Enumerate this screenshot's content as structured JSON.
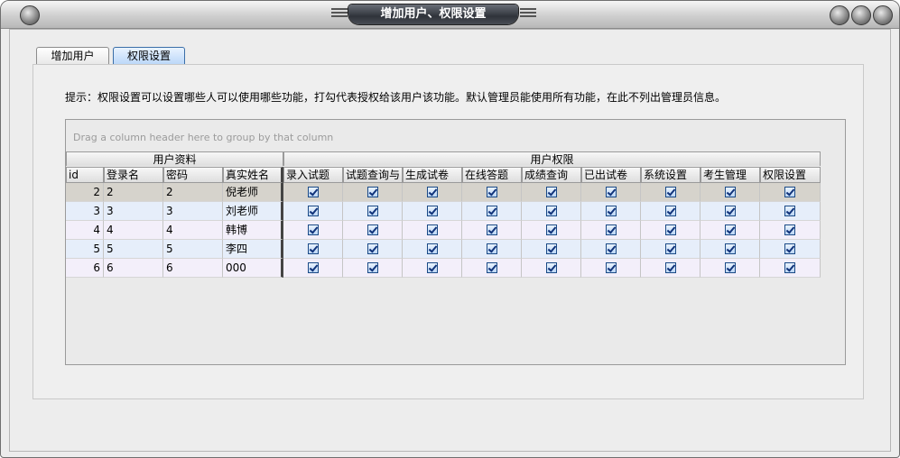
{
  "window": {
    "title": "增加用户、权限设置"
  },
  "tabs": [
    {
      "label": "增加用户",
      "active": false
    },
    {
      "label": "权限设置",
      "active": true
    }
  ],
  "hint": "提示：权限设置可以设置哪些人可以使用哪些功能，打勾代表授权给该用户该功能。默认管理员能使用所有功能，在此不列出管理员信息。",
  "grid": {
    "group_placeholder": "Drag a column header here to group by that column",
    "bands": [
      "用户资料",
      "用户权限"
    ],
    "columns": [
      "id",
      "登录名",
      "密码",
      "真实姓名",
      "录入试题",
      "试题查询与",
      "生成试卷",
      "在线答题",
      "成绩查询",
      "已出试卷",
      "系统设置",
      "考生管理",
      "权限设置"
    ],
    "rows": [
      {
        "id": "2",
        "login": "2",
        "password": "2",
        "name": "倪老师",
        "perms": [
          true,
          true,
          true,
          true,
          true,
          true,
          true,
          true,
          true
        ]
      },
      {
        "id": "3",
        "login": "3",
        "password": "3",
        "name": "刘老师",
        "perms": [
          true,
          true,
          true,
          true,
          true,
          true,
          true,
          true,
          true
        ]
      },
      {
        "id": "4",
        "login": "4",
        "password": "4",
        "name": "韩博",
        "perms": [
          true,
          true,
          true,
          true,
          true,
          true,
          true,
          true,
          true
        ]
      },
      {
        "id": "5",
        "login": "5",
        "password": "5",
        "name": "李四",
        "perms": [
          true,
          true,
          true,
          true,
          true,
          true,
          true,
          true,
          true
        ]
      },
      {
        "id": "6",
        "login": "6",
        "password": "6",
        "name": "000",
        "perms": [
          true,
          true,
          true,
          true,
          true,
          true,
          true,
          true,
          true
        ]
      }
    ]
  }
}
